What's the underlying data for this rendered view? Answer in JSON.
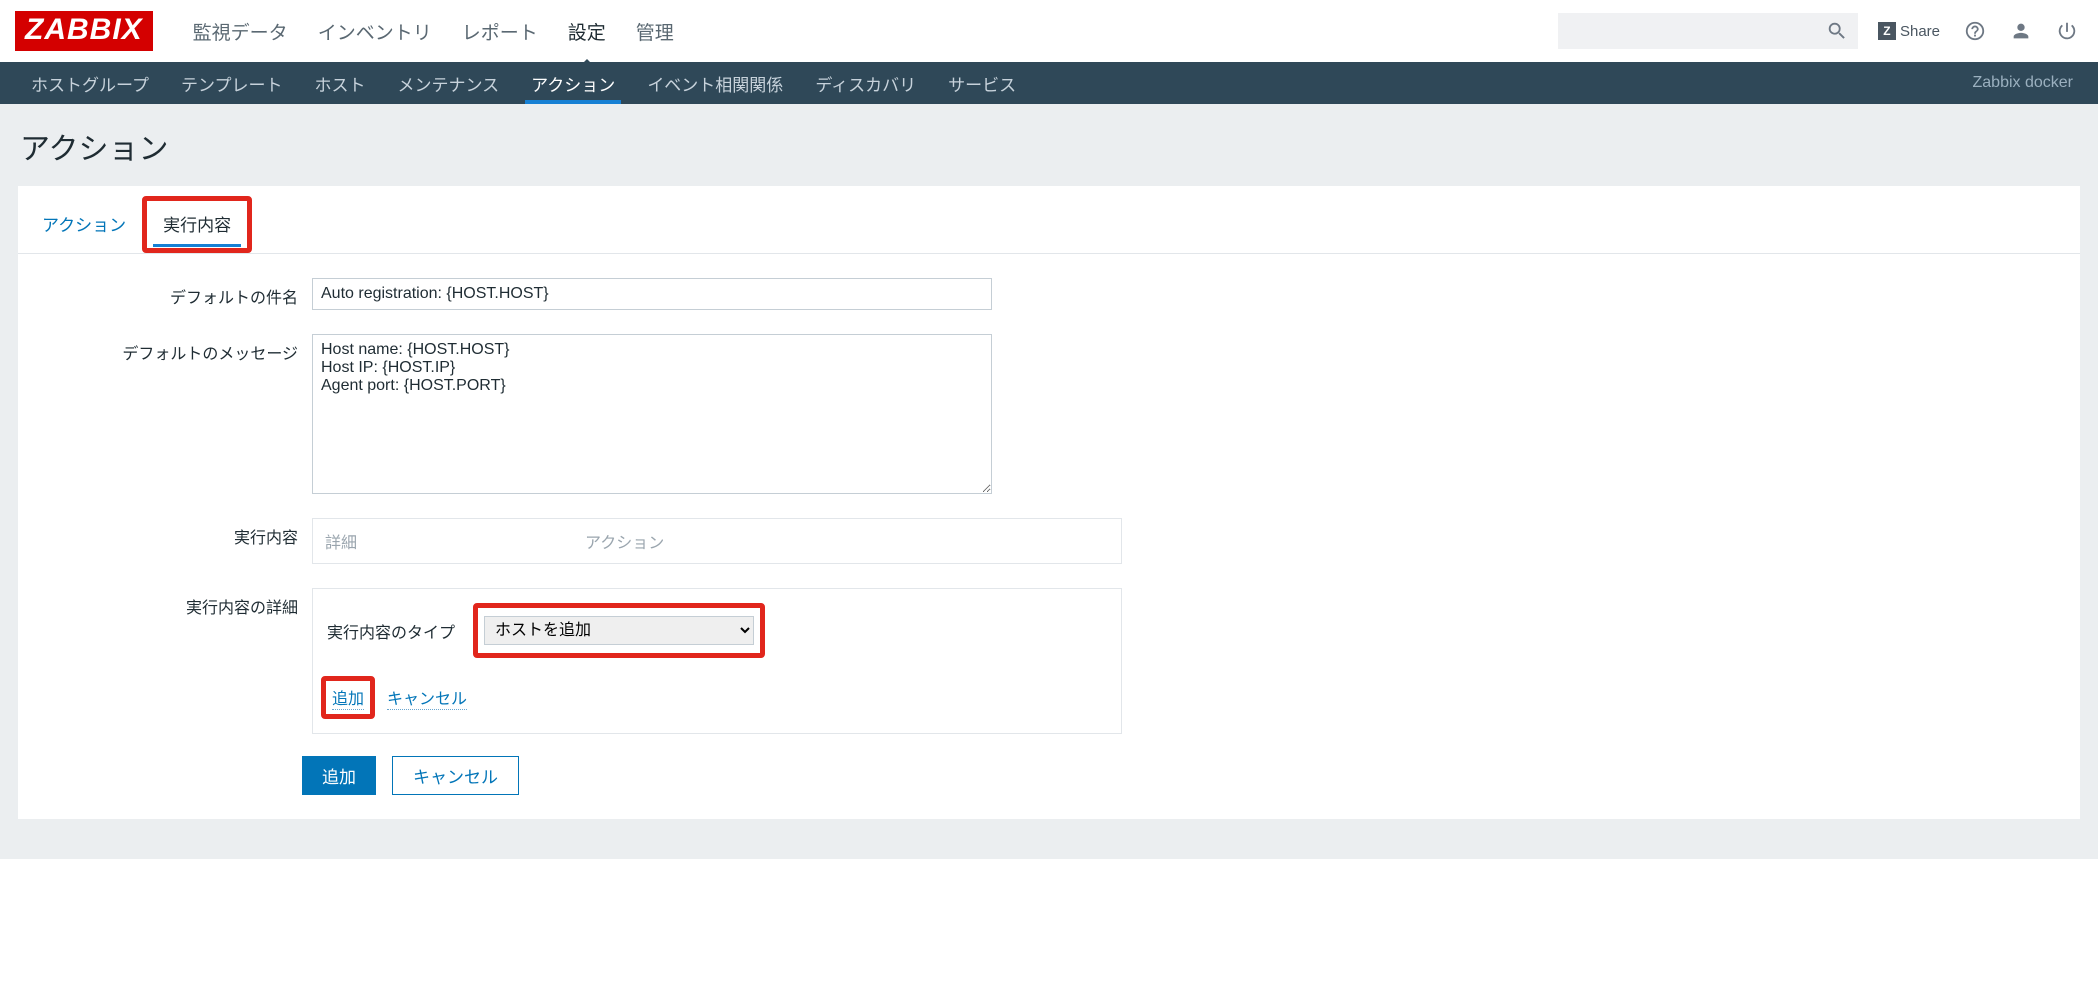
{
  "topnav": {
    "logo": "ZABBIX",
    "items": [
      "監視データ",
      "インベントリ",
      "レポート",
      "設定",
      "管理"
    ],
    "active_index": 3,
    "share": "Share"
  },
  "subnav": {
    "items": [
      "ホストグループ",
      "テンプレート",
      "ホスト",
      "メンテナンス",
      "アクション",
      "イベント相関関係",
      "ディスカバリ",
      "サービス"
    ],
    "active_index": 4,
    "server": "Zabbix docker"
  },
  "page": {
    "title": "アクション"
  },
  "tabs": {
    "action": "アクション",
    "operations": "実行内容"
  },
  "form": {
    "subject_label": "デフォルトの件名",
    "subject_value": "Auto registration: {HOST.HOST}",
    "message_label": "デフォルトのメッセージ",
    "message_value": "Host name: {HOST.HOST}\nHost IP: {HOST.IP}\nAgent port: {HOST.PORT}",
    "operations_label": "実行内容",
    "operations_col1": "詳細",
    "operations_col2": "アクション",
    "details_label": "実行内容の詳細",
    "type_label": "実行内容のタイプ",
    "type_value": "ホストを追加",
    "add_link": "追加",
    "cancel_link": "キャンセル"
  },
  "buttons": {
    "add": "追加",
    "cancel": "キャンセル"
  }
}
